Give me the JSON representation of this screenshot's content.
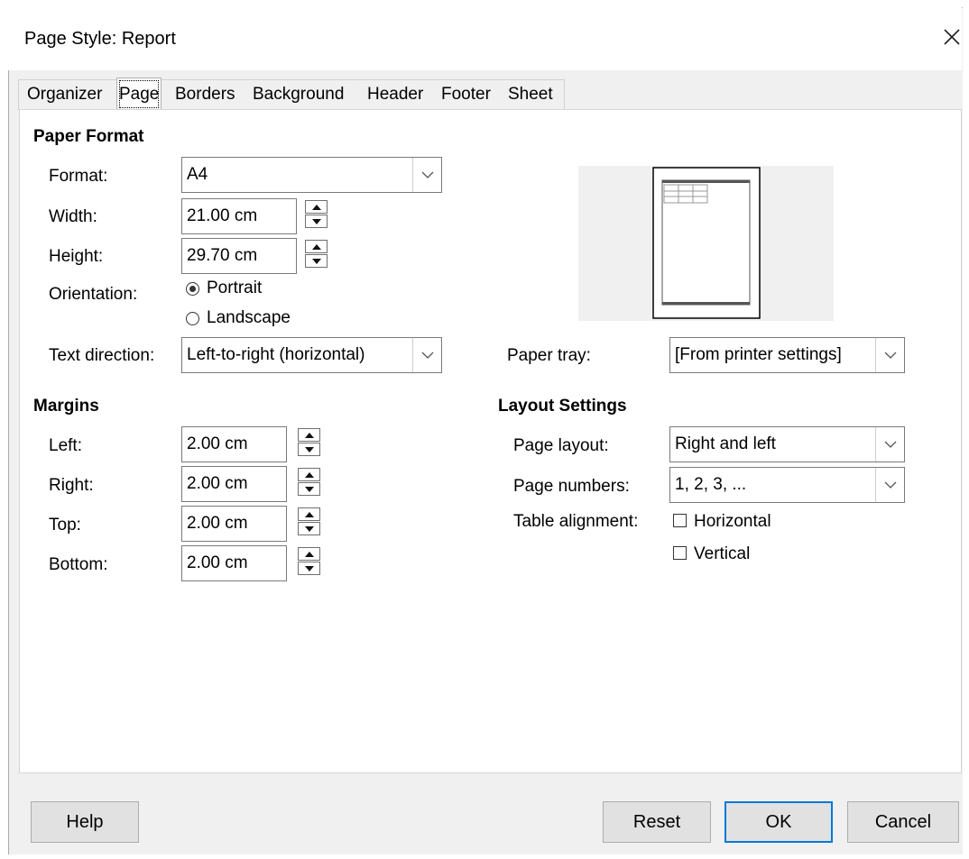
{
  "window": {
    "title": "Page Style: Report"
  },
  "tabs": [
    {
      "label": "Organizer"
    },
    {
      "label": "Page"
    },
    {
      "label": "Borders"
    },
    {
      "label": "Background"
    },
    {
      "label": "Header"
    },
    {
      "label": "Footer"
    },
    {
      "label": "Sheet"
    }
  ],
  "active_tab": "Page",
  "paper_format": {
    "heading": "Paper Format",
    "format": {
      "label": "Format:",
      "value": "A4"
    },
    "width": {
      "label": "Width:",
      "value": "21.00 cm"
    },
    "height": {
      "label": "Height:",
      "value": "29.70 cm"
    },
    "orientation": {
      "label": "Orientation:",
      "portrait": "Portrait",
      "landscape": "Landscape",
      "selected": "Portrait"
    },
    "text_direction": {
      "label": "Text direction:",
      "value": "Left-to-right (horizontal)"
    }
  },
  "paper_tray": {
    "label": "Paper tray:",
    "value": "[From printer settings]"
  },
  "margins": {
    "heading": "Margins",
    "left": {
      "label": "Left:",
      "value": "2.00 cm"
    },
    "right": {
      "label": "Right:",
      "value": "2.00 cm"
    },
    "top": {
      "label": "Top:",
      "value": "2.00 cm"
    },
    "bottom": {
      "label": "Bottom:",
      "value": "2.00 cm"
    }
  },
  "layout_settings": {
    "heading": "Layout Settings",
    "page_layout": {
      "label": "Page layout:",
      "value": "Right and left"
    },
    "page_numbers": {
      "label": "Page numbers:",
      "value": "1, 2, 3, ..."
    },
    "table_alignment": {
      "label": "Table alignment:",
      "horizontal": "Horizontal",
      "vertical": "Vertical",
      "horizontal_checked": false,
      "vertical_checked": false
    }
  },
  "buttons": {
    "help": "Help",
    "reset": "Reset",
    "ok": "OK",
    "cancel": "Cancel"
  }
}
